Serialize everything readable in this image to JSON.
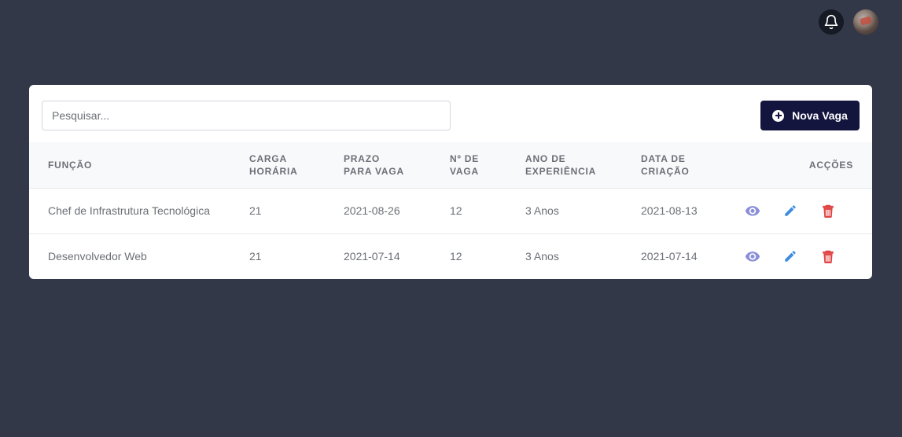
{
  "header": {
    "notification_icon": "bell-icon",
    "avatar": "user-avatar"
  },
  "toolbar": {
    "search_placeholder": "Pesquisar...",
    "search_value": "",
    "new_button_label": "Nova Vaga",
    "new_button_icon": "plus-circle-icon"
  },
  "table": {
    "columns": [
      "FUNÇÃO",
      "CARGA HORÁRIA",
      "PRAZO PARA VAGA",
      "Nº DE VAGA",
      "ANO DE EXPERIÊNCIA",
      "DATA DE CRIAÇÃO",
      "ACÇÕES"
    ],
    "rows": [
      {
        "funcao": "Chef de Infrastrutura Tecnológica",
        "carga": "21",
        "prazo": "2021-08-26",
        "vagas": "12",
        "experiencia": "3 Anos",
        "criacao": "2021-08-13"
      },
      {
        "funcao": "Desenvolvedor Web",
        "carga": "21",
        "prazo": "2021-07-14",
        "vagas": "12",
        "experiencia": "3 Anos",
        "criacao": "2021-07-14"
      }
    ],
    "action_icons": [
      "eye-icon",
      "pencil-icon",
      "trash-icon"
    ]
  },
  "colors": {
    "background": "#333849",
    "card": "#ffffff",
    "primary_button": "#14153f",
    "view_icon": "#8b8fd9",
    "edit_icon": "#3f8de0",
    "delete_icon": "#e04545"
  }
}
